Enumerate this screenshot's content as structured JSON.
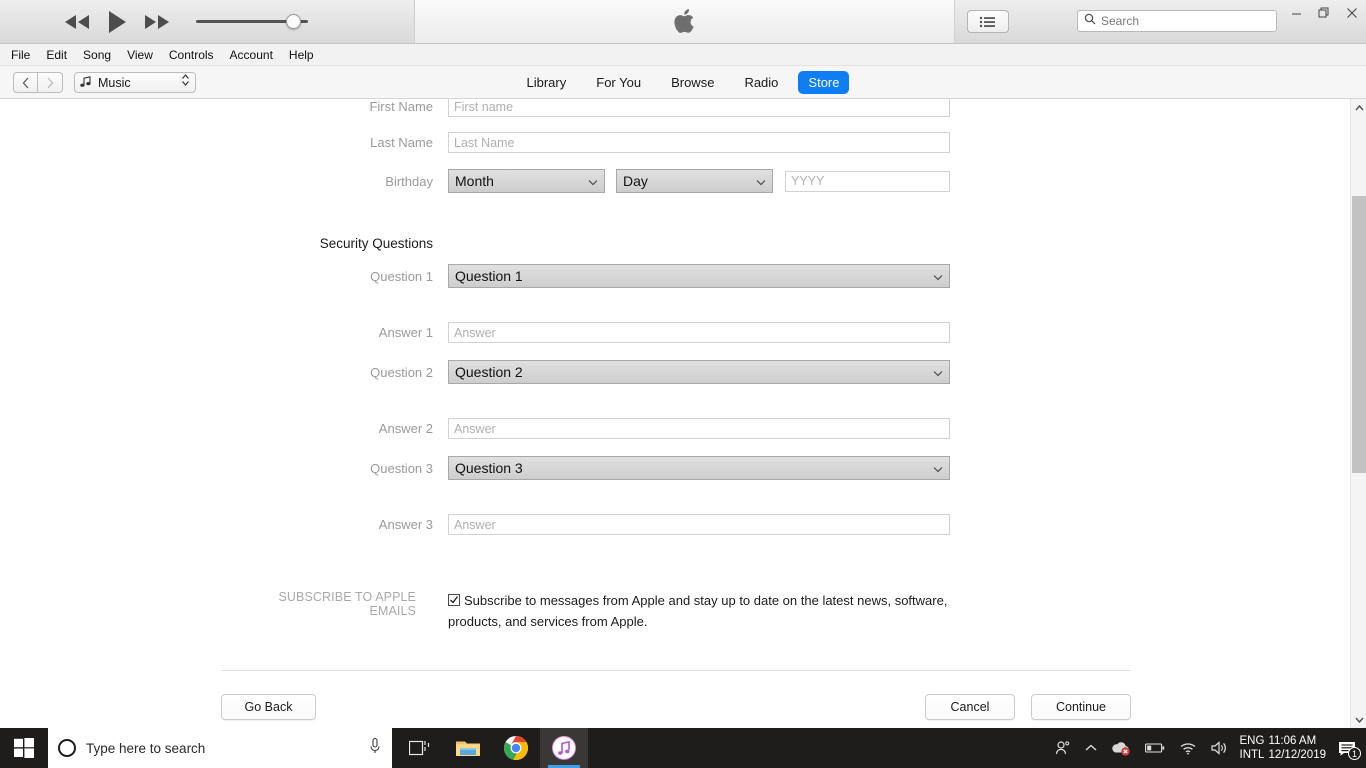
{
  "window": {
    "minimize_label": "—",
    "maximize_label": "❐",
    "close_label": "✕"
  },
  "player": {
    "rewind_icon": "rewind-icon",
    "play_icon": "play-icon",
    "fastforward_icon": "fast-forward-icon",
    "volume_icon": "volume-slider",
    "apple_logo": "apple-logo",
    "listview_icon": "list-view-icon"
  },
  "search": {
    "placeholder": "Search",
    "icon": "search-icon"
  },
  "menubar": {
    "items": [
      {
        "label": "File"
      },
      {
        "label": "Edit"
      },
      {
        "label": "Song"
      },
      {
        "label": "View"
      },
      {
        "label": "Controls"
      },
      {
        "label": "Account"
      },
      {
        "label": "Help"
      }
    ]
  },
  "navbar": {
    "back_icon": "chevron-left-icon",
    "forward_icon": "chevron-right-icon",
    "library_select": {
      "value": "Music",
      "icon": "music-note-icon",
      "chevron": "updown-chevron-icon"
    },
    "tabs": [
      {
        "label": "Library",
        "active": false
      },
      {
        "label": "For You",
        "active": false
      },
      {
        "label": "Browse",
        "active": false
      },
      {
        "label": "Radio",
        "active": false
      },
      {
        "label": "Store",
        "active": true
      }
    ],
    "active_color": "#0f7ef2"
  },
  "form": {
    "first_name": {
      "label": "First Name",
      "placeholder": "First name",
      "value": ""
    },
    "last_name": {
      "label": "Last Name",
      "placeholder": "Last Name",
      "value": ""
    },
    "birthday": {
      "label": "Birthday",
      "month": {
        "value": "Month"
      },
      "day": {
        "value": "Day"
      },
      "year": {
        "placeholder": "YYYY",
        "value": ""
      }
    },
    "security_heading": "Security Questions",
    "questions": [
      {
        "q_label": "Question 1",
        "q_value": "Question 1",
        "a_label": "Answer 1",
        "a_placeholder": "Answer",
        "a_value": ""
      },
      {
        "q_label": "Question 2",
        "q_value": "Question 2",
        "a_label": "Answer 2",
        "a_placeholder": "Answer",
        "a_value": ""
      },
      {
        "q_label": "Question 3",
        "q_value": "Question 3",
        "a_label": "Answer 3",
        "a_placeholder": "Answer",
        "a_value": ""
      }
    ],
    "subscribe": {
      "label": "SUBSCRIBE TO APPLE EMAILS",
      "text": "Subscribe to messages from Apple and stay up to date on the latest news, software, products, and services from Apple.",
      "checked": true
    },
    "buttons": {
      "go_back": "Go Back",
      "cancel": "Cancel",
      "continue": "Continue"
    }
  },
  "scrollbar": {
    "up_icon": "scroll-up-arrow-icon",
    "down_icon": "scroll-down-arrow-icon"
  },
  "taskbar": {
    "start_icon": "windows-start-icon",
    "search_placeholder": "Type here to search",
    "mic_icon": "microphone-icon",
    "taskview_icon": "task-view-icon",
    "explorer_icon": "file-explorer-icon",
    "chrome_icon": "google-chrome-icon",
    "itunes_icon": "itunes-icon",
    "people_icon": "people-icon",
    "show_hidden_icon": "show-hidden-icons-chevron",
    "onedrive_icon": "onedrive-error-icon",
    "battery_icon": "battery-icon",
    "wifi_icon": "wifi-icon",
    "volume_icon": "speaker-icon",
    "language_line1": "ENG",
    "language_line2": "INTL",
    "time": "11:06 AM",
    "date": "12/12/2019",
    "notification_icon": "action-center-icon",
    "notification_count": "1"
  }
}
